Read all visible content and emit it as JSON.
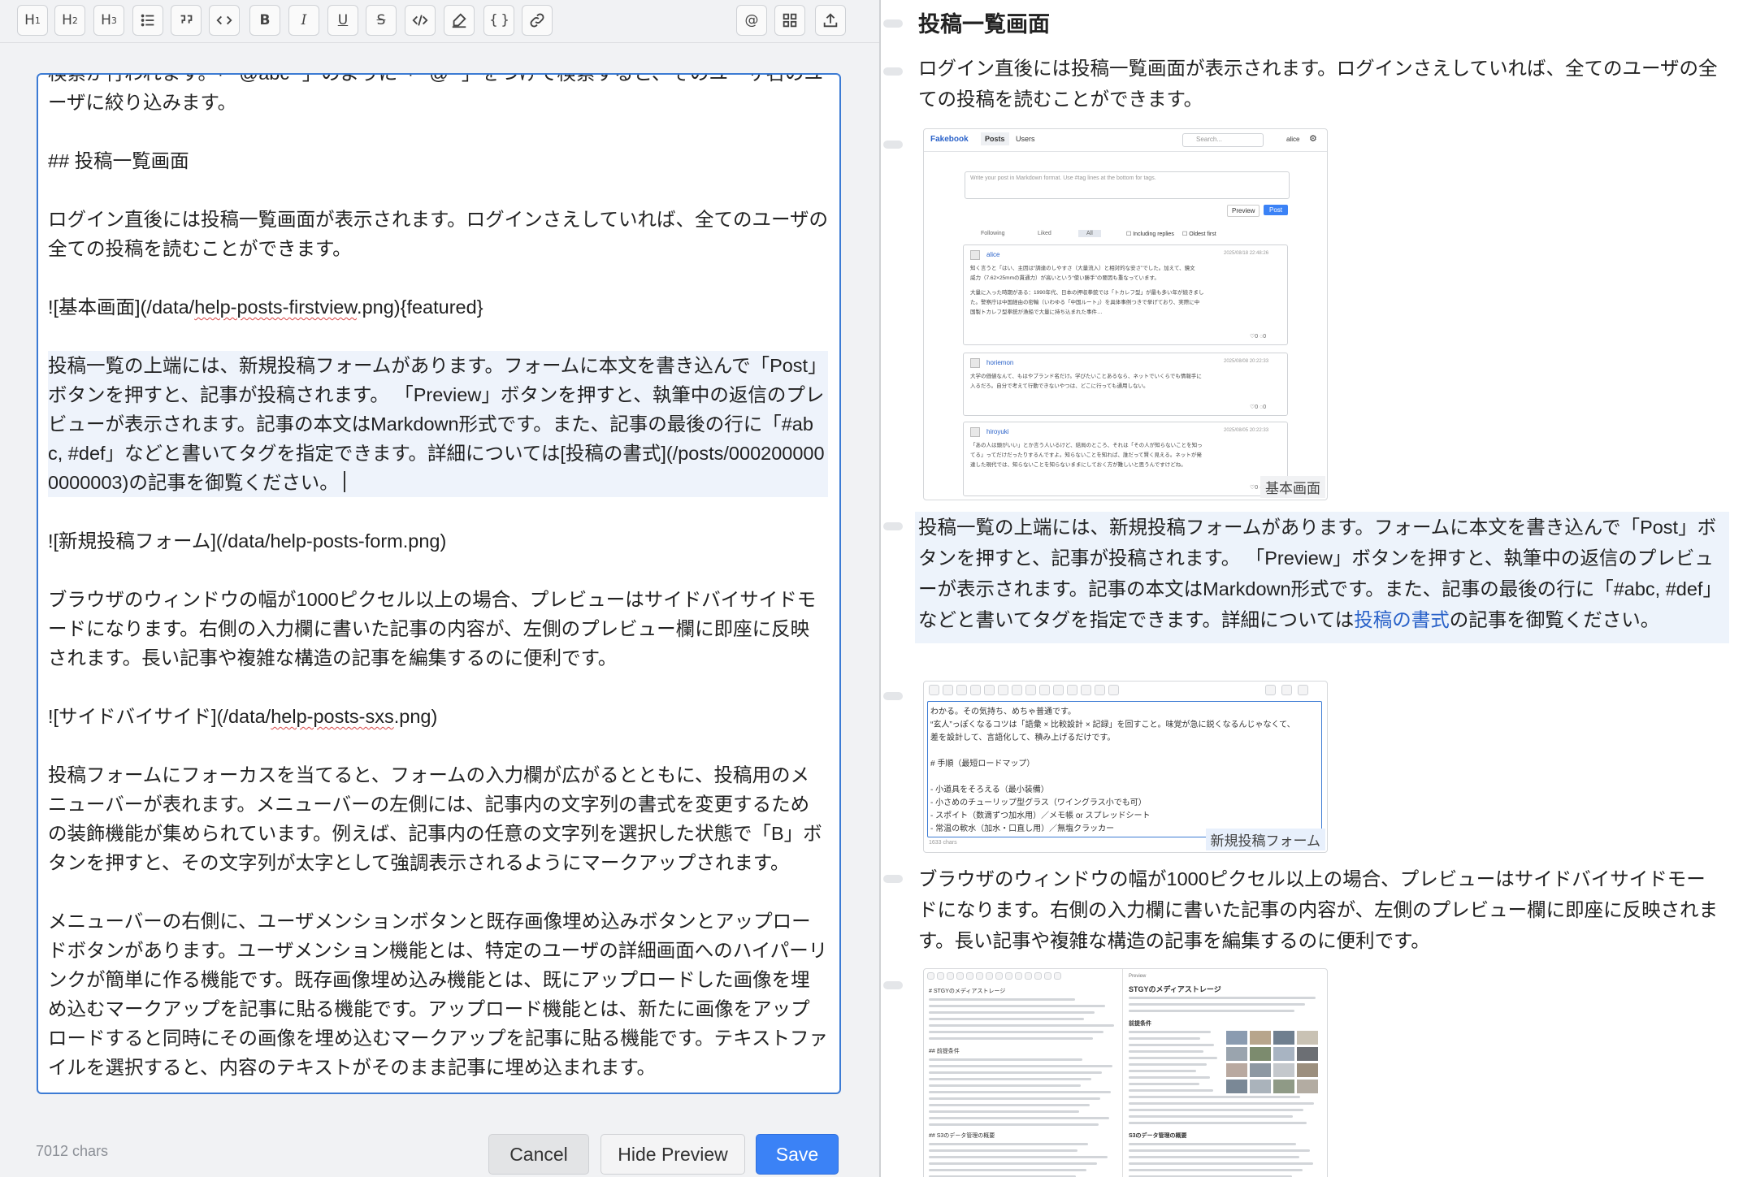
{
  "toolbar": {
    "buttons": [
      {
        "icon": "heading-1-icon",
        "label": "H",
        "sub": "1"
      },
      {
        "icon": "heading-2-icon",
        "label": "H",
        "sub": "2"
      },
      {
        "icon": "heading-3-icon",
        "label": "H",
        "sub": "3"
      },
      {
        "icon": "bullet-list-icon"
      },
      {
        "icon": "quote-icon"
      },
      {
        "icon": "code-icon"
      },
      {
        "icon": "bold-icon",
        "label": "B"
      },
      {
        "icon": "italic-icon",
        "label": "I"
      },
      {
        "icon": "underline-icon",
        "label": "U"
      },
      {
        "icon": "strikethrough-icon",
        "label": "S"
      },
      {
        "icon": "inline-code-icon"
      },
      {
        "icon": "highlighter-icon"
      },
      {
        "icon": "braces-icon",
        "label": "{ }"
      },
      {
        "icon": "link-icon"
      }
    ],
    "right_buttons": [
      {
        "icon": "mention-icon",
        "label": "@"
      },
      {
        "icon": "image-grid-icon"
      },
      {
        "icon": "upload-icon"
      }
    ]
  },
  "editor": {
    "lines": [
      "検索が行われます。「``@abc``」のように「``@``」をつけて検索すると、そのユーザ名のユーザに絞り込みます。",
      "",
      "## 投稿一覧画面",
      "",
      "ログイン直後には投稿一覧画面が表示されます。ログインさえしていれば、全てのユーザの全ての投稿を読むことができます。",
      "",
      "![基本画面](/data/help-posts-firstview.png){featured}",
      "",
      "投稿一覧の上端には、新規投稿フォームがあります。フォームに本文を書き込んで「Post」ボタンを押すと、記事が投稿されます。 「Preview」ボタンを押すと、執筆中の返信のプレビューが表示されます。記事の本文はMarkdown形式です。また、記事の最後の行に「#abc, #def」などと書いてタグを指定できます。詳細については[投稿の書式](/posts/0002000000000003)の記事を御覧ください。",
      "",
      "![新規投稿フォーム](/data/help-posts-form.png)",
      "",
      "ブラウザのウィンドウの幅が1000ピクセル以上の場合、プレビューはサイドバイサイドモードになります。右側の入力欄に書いた記事の内容が、左側のプレビュー欄に即座に反映されます。長い記事や複雑な構造の記事を編集するのに便利です。",
      "",
      "![サイドバイサイド](/data/help-posts-sxs.png)",
      "",
      "投稿フォームにフォーカスを当てると、フォームの入力欄が広がるとともに、投稿用のメニューバーが表れます。メニューバーの左側には、記事内の文字列の書式を変更するための装飾機能が集められています。例えば、記事内の任意の文字列を選択した状態で「B」ボタンを押すと、その文字列が太字として強調表示されるようにマークアップされます。",
      "",
      "メニューバーの右側に、ユーザメンションボタンと既存画像埋め込みボタンとアップロードボタンがあります。ユーザメンション機能とは、特定のユーザの詳細画面へのハイパーリンクが簡単に作る機能です。既存画像埋め込み機能とは、既にアップロードした画像を埋め込むマークアップを記事に貼る機能です。アップロード機能とは、新たに画像をアップロードすると同時にその画像を埋め込むマークアップを記事に貼る機能です。テキストファイルを選択すると、内容のテキストがそのまま記事に埋め込まれます。"
    ],
    "char_count": "7012 chars"
  },
  "footer": {
    "cancel": "Cancel",
    "hide_preview": "Hide Preview",
    "save": "Save"
  },
  "preview": {
    "heading": "投稿一覧画面",
    "para1": "ログイン直後には投稿一覧画面が表示されます。ログインさえしていれば、全てのユーザの全ての投稿を読むことができます。",
    "image1_caption": "基本画面",
    "para2_before": "投稿一覧の上端には、新規投稿フォームがあります。フォームに本文を書き込んで「Post」ボタンを押すと、記事が投稿されます。 「Preview」ボタンを押すと、執筆中の返信のプレビューが表示されます。記事の本文はMarkdown形式です。また、記事の最後の行に「#abc, #def」などと書いてタグを指定できます。詳細については",
    "para2_link": "投稿の書式",
    "para2_after": "の記事を御覧ください。",
    "image2_caption": "新規投稿フォーム",
    "para3": "ブラウザのウィンドウの幅が1000ピクセル以上の場合、プレビューはサイドバイサイドモードになります。右側の入力欄に書いた記事の内容が、左側のプレビュー欄に即座に反映されます。長い記事や複雑な構造の記事を編集するのに便利です。"
  },
  "thumb1": {
    "brand": "Fakebook",
    "nav_posts": "Posts",
    "nav_users": "Users",
    "search_placeholder": "Search...",
    "user": "alice",
    "textarea_placeholder": "Write your post in Markdown format. Use #tag lines at the bottom for tags.",
    "preview_btn": "Preview",
    "post_btn": "Post",
    "tabs": [
      "Following",
      "Liked",
      "All"
    ],
    "including_replies": "Including replies",
    "oldest_first": "Oldest first",
    "posts": [
      {
        "author": "alice",
        "date": "2025/08/18 22:48:26",
        "l1": "知く言うと「はい、主因は“調達のしやすさ（大量流入）と相対的な安さ”でした。加えて、鏡文",
        "l2": "威力（7.62×25mmの貫通力）が高いという“使い勝手”の要因も重なっています。",
        "l3": "大量に入った時期がある：1990年代、日本の押収拳銃では「トカレフ型」が最も多い年が続きまし",
        "l4": "た。警察庁は中国経由の密輸（いわゆる「中国ルート」）を具体事例つきで挙げており、実際に中",
        "l5": "国製トカレフ型拳銃が漁船で大量に持ち込まれた事件…"
      },
      {
        "author": "horiemon",
        "date": "2025/08/08 20:22:33",
        "l1": "大学の価値なんて、もはやブランド名だけ。学びたいことあるなら、ネットでいくらでも情報手に",
        "l2": "入るだろ。自分で考えて行動できないやつは、どこに行っても通用しない。"
      },
      {
        "author": "hiroyuki",
        "date": "2025/08/05 20:22:33",
        "l1": "「あの人は頭がいい」とか言う人いるけど、結局のところ、それは「その人が知らないことを知っ",
        "l2": "てる」ってだけだったりするんですよ。知らないことを知れば、誰だって賢く見える。ネットが発",
        "l3": "達した現代では、知らないことを知らないままにしておく方が難しいと思うんですけどね。"
      }
    ]
  },
  "thumb2": {
    "lines": [
      "わかる。その気持ち、めちゃ普通です。",
      "“玄人”っぽくなるコツは「語彙 × 比較設計 × 記録」を回すこと。味覚が急に鋭くなるんじゃなくて、",
      "差を設計して、言語化して、積み上げるだけです。",
      "",
      "# 手順（最短ロードマップ）",
      "",
      "- 小道具をそろえる（最小装備）",
      "  - 小さめのチューリップ型グラス（ワイングラス小でも可）",
      "  - スポイト（数滴ずつ加水用）／メモ帳 or スプレッドシート",
      "  - 常温の軟水（加水・口直し用）／無塩クラッカー"
    ],
    "chars": "1633 chars"
  },
  "thumb3": {
    "left_title": "# STGYのメディアストレージ",
    "right_label": "Preview",
    "right_title": "STGYのメディアストレージ",
    "right_h2": "前提条件",
    "right_h3": "S3のデータ管理の概要",
    "left_h": "## 前提条件",
    "left_h2": "## S3のデータ管理の概要"
  }
}
